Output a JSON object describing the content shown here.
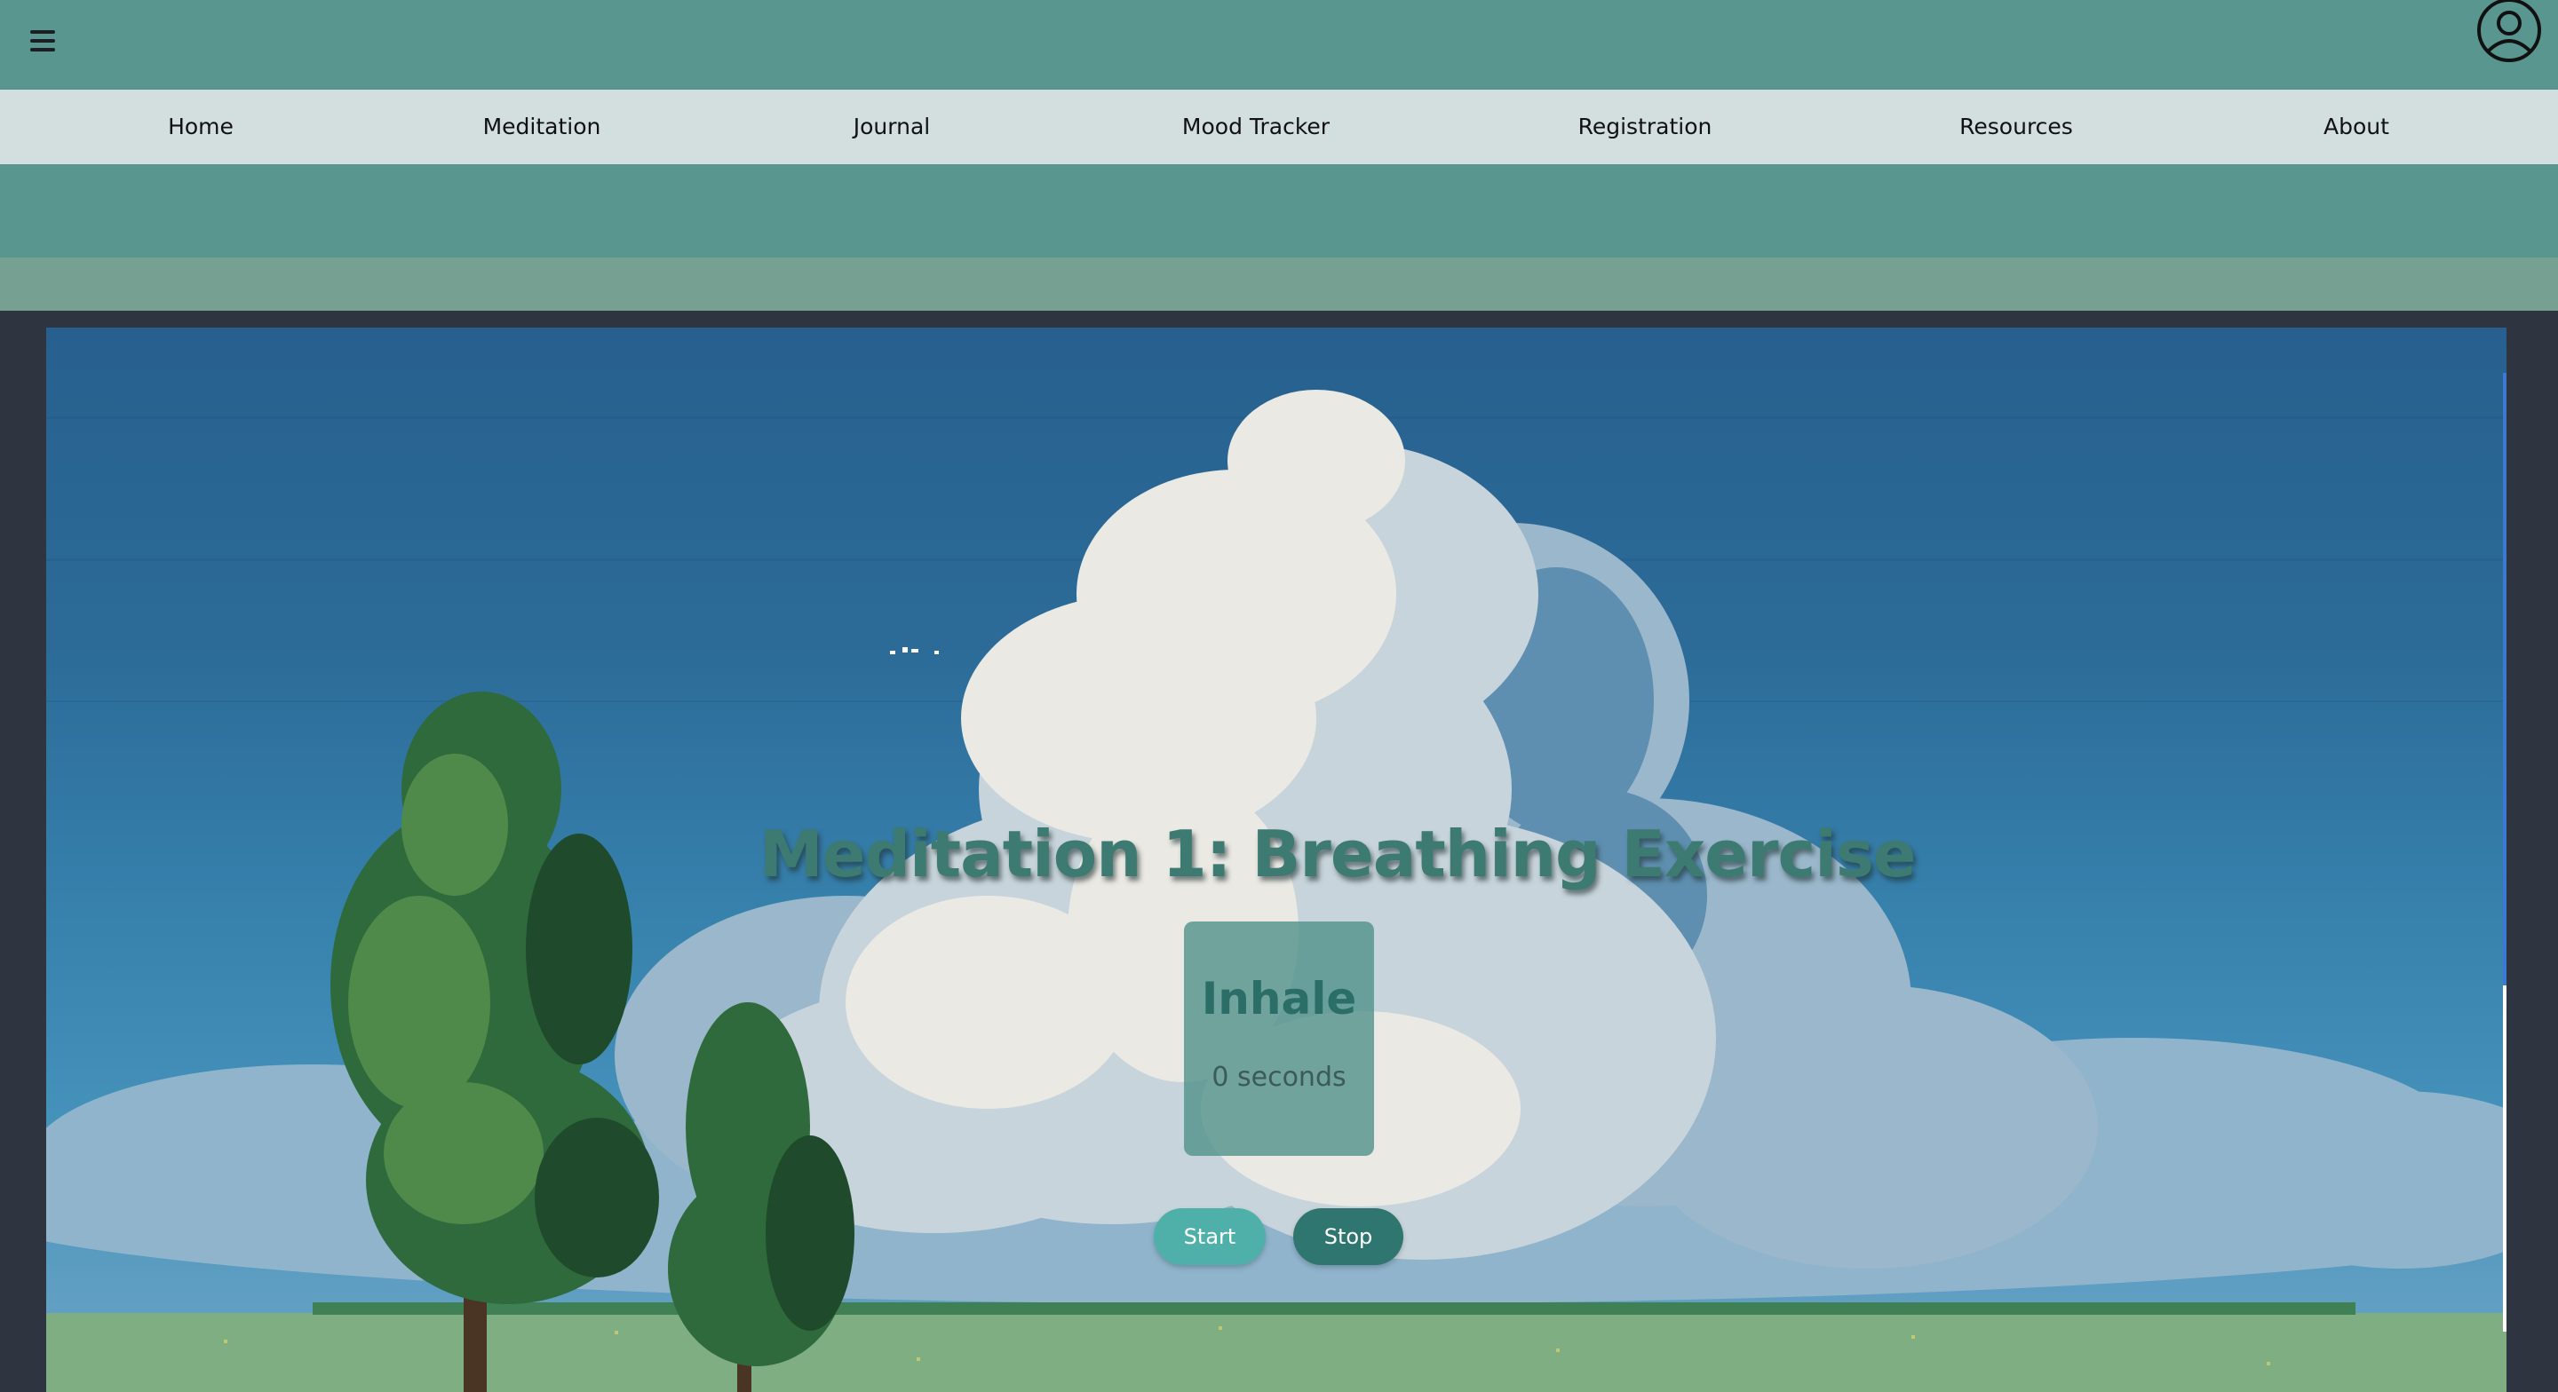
{
  "header": {
    "menu_icon": "hamburger-menu-icon",
    "profile_icon": "user-circle-icon"
  },
  "nav": {
    "items": [
      {
        "label": "Home"
      },
      {
        "label": "Meditation"
      },
      {
        "label": "Journal"
      },
      {
        "label": "Mood Tracker"
      },
      {
        "label": "Registration"
      },
      {
        "label": "Resources"
      },
      {
        "label": "About"
      }
    ]
  },
  "exercise": {
    "title": "Meditation 1: Breathing Exercise",
    "phase": "Inhale",
    "timer": "0 seconds",
    "start_label": "Start",
    "stop_label": "Stop"
  },
  "colors": {
    "header_bg": "#5a9690",
    "nav_bg": "#d3dfdf",
    "accent_teal": "#4fb0aa",
    "dark_teal": "#2f7670",
    "title_color": "#3d7a72"
  }
}
